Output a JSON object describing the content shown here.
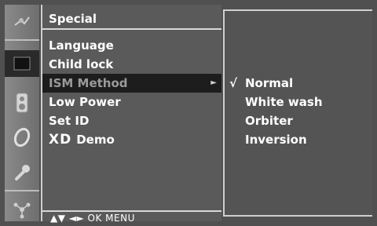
{
  "menu": {
    "title": "Special",
    "items": [
      {
        "label": "Language"
      },
      {
        "label": "Child lock"
      },
      {
        "label": "ISM Method",
        "selected": true,
        "arrow": "►"
      },
      {
        "label": "Low Power"
      },
      {
        "label": "Set ID"
      },
      {
        "label": "Demo",
        "logo": "XD"
      }
    ],
    "footer": "▲▼ ◄► OK  MENU"
  },
  "submenu": {
    "check_mark": "√",
    "options": [
      "Normal",
      "White wash",
      "Orbiter",
      "Inversion"
    ],
    "selected_index": 0
  },
  "rail": {
    "icons": [
      "picture-setup-icon",
      "screen-icon",
      "audio-icon",
      "time-icon",
      "special-icon",
      "screen-position-icon"
    ],
    "active_index": 1
  },
  "colors": {
    "background": "#505050",
    "highlight": "#1d1d1d",
    "text": "#ffffff"
  }
}
